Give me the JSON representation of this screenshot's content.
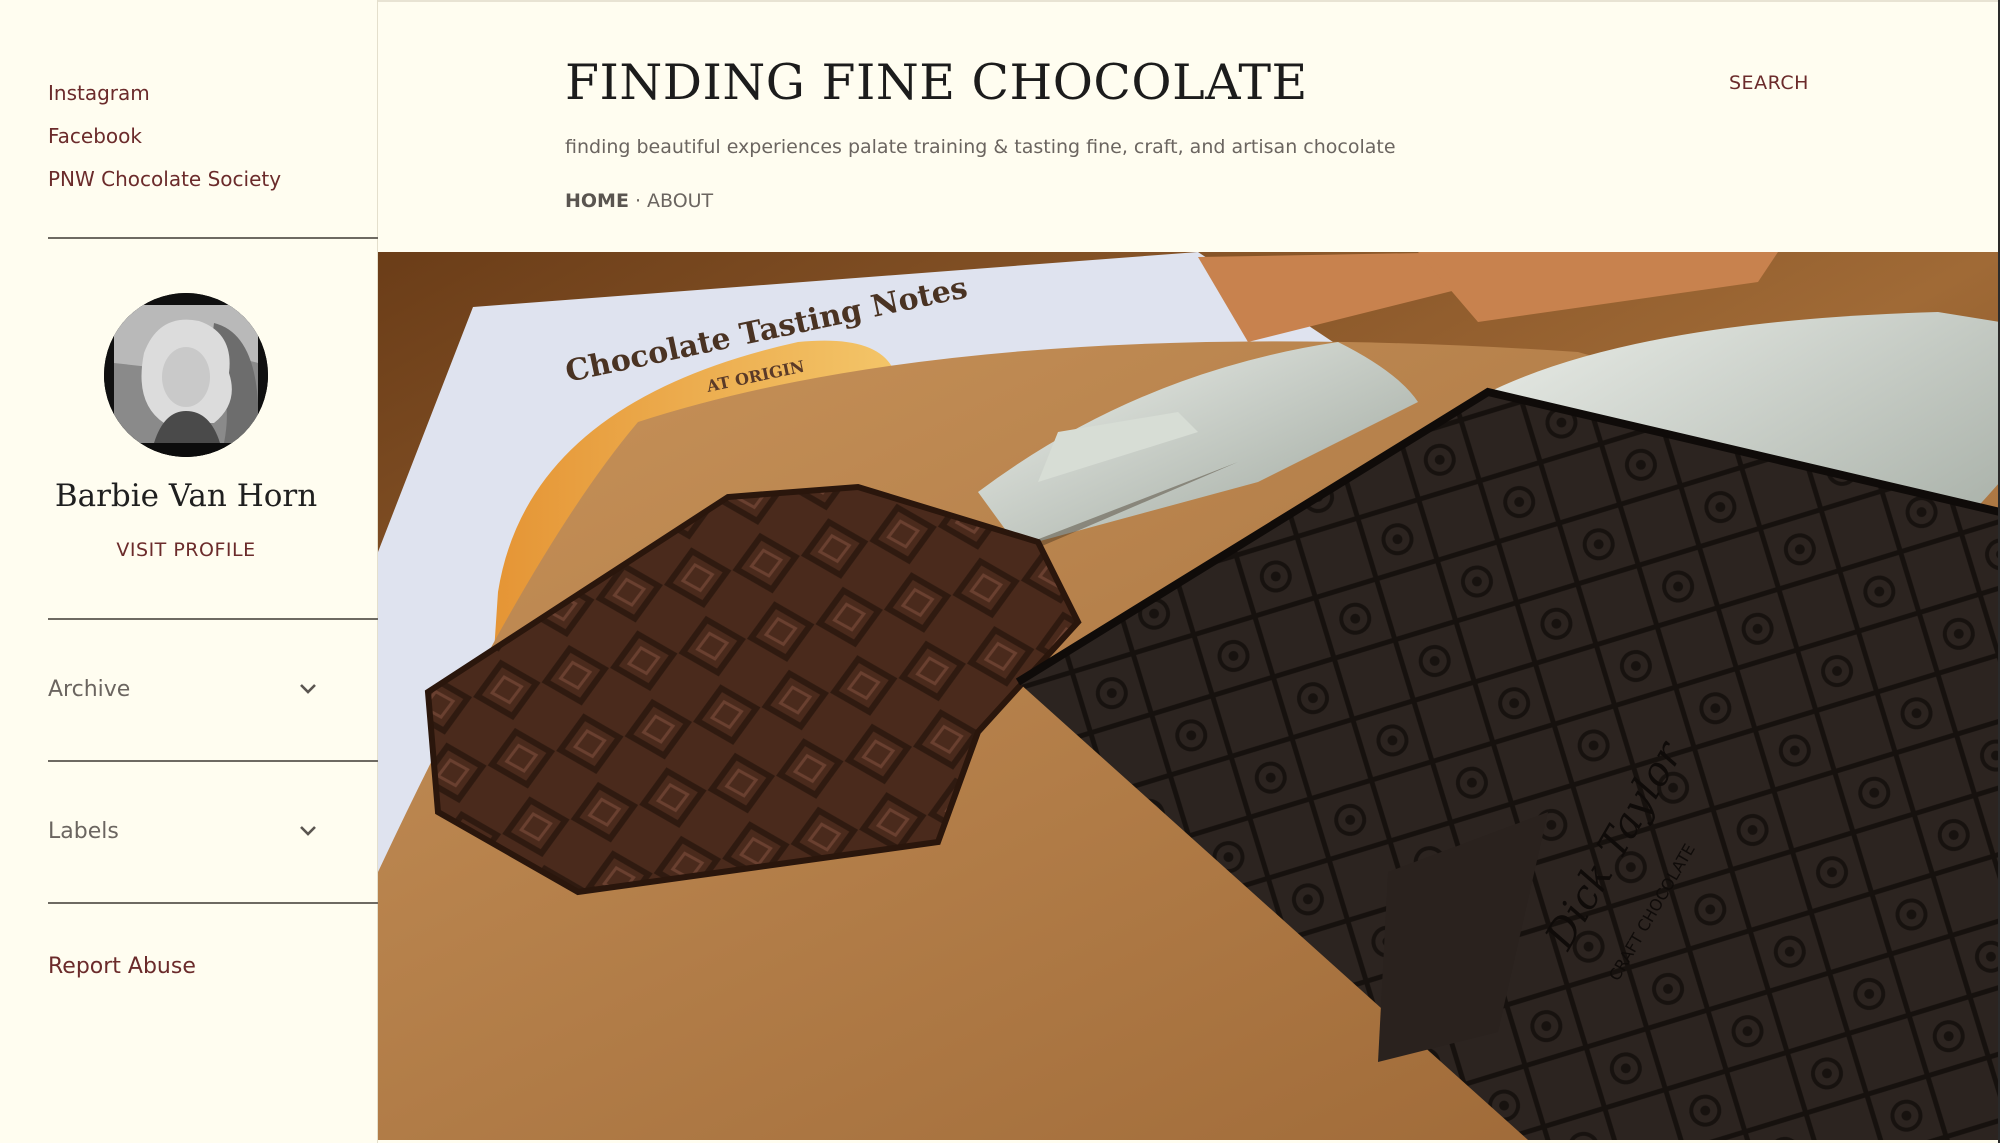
{
  "sidebar": {
    "links": [
      {
        "label": "Instagram"
      },
      {
        "label": "Facebook"
      },
      {
        "label": "PNW Chocolate Society"
      }
    ],
    "profile": {
      "name": "Barbie Van Horn",
      "visit_label": "VISIT PROFILE"
    },
    "widgets": [
      {
        "label": "Archive",
        "icon": "chevron-down-icon"
      },
      {
        "label": "Labels",
        "icon": "chevron-down-icon"
      }
    ],
    "report_abuse": "Report Abuse"
  },
  "header": {
    "title": "FINDING FINE CHOCOLATE",
    "tagline": "finding beautiful experiences palate training & tasting fine, craft, and artisan chocolate",
    "search_label": "SEARCH",
    "nav": [
      {
        "label": "HOME",
        "active": true
      },
      {
        "label": "ABOUT",
        "active": false
      }
    ],
    "nav_separator": "·"
  },
  "hero": {
    "book_title": "Chocolate Tasting Notes",
    "book_subtitle": "AT ORIGIN",
    "brand_text": "Dick Taylor",
    "brand_sub": "CRAFT CHOCOLATE"
  },
  "colors": {
    "background": "#fffdf0",
    "link": "#6b2b2b",
    "text_muted": "#6b6560",
    "title": "#1c1c1c"
  }
}
